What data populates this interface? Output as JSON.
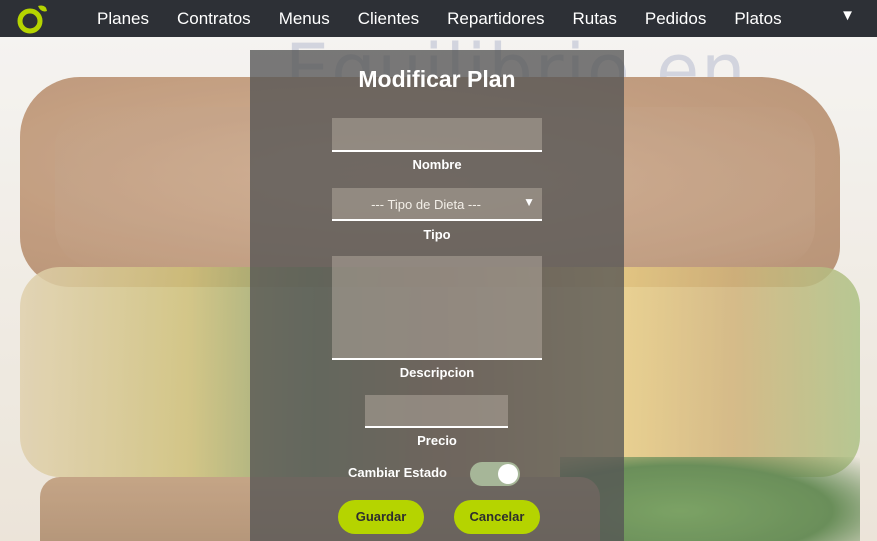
{
  "nav": {
    "items": [
      "Planes",
      "Contratos",
      "Menus",
      "Clientes",
      "Repartidores",
      "Rutas",
      "Pedidos",
      "Platos"
    ],
    "toggle_glyph": "▼",
    "brand_color": "#b5d400"
  },
  "form": {
    "title": "Modificar Plan",
    "nombre": {
      "value": "",
      "label": "Nombre"
    },
    "tipo": {
      "selected": "--- Tipo de Dieta ---",
      "label": "Tipo",
      "caret": "▼"
    },
    "descripcion": {
      "value": "",
      "label": "Descripcion"
    },
    "precio": {
      "value": "",
      "label": "Precio"
    },
    "estado": {
      "label": "Cambiar Estado",
      "on": true
    },
    "guardar_label": "Guardar",
    "cancelar_label": "Cancelar"
  },
  "icons": {
    "logo": "brand-logo-icon",
    "caret": "chevron-down-icon"
  }
}
